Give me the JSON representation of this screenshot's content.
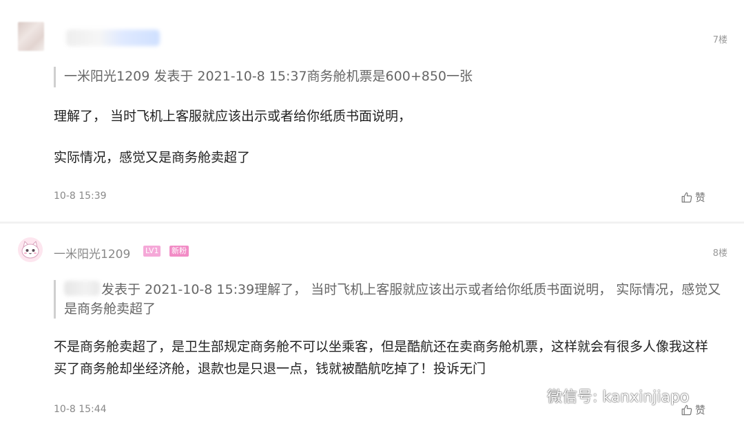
{
  "posts": [
    {
      "floor": "7楼",
      "quote": {
        "text": "一米阳光1209 发表于 2021-10-8 15:37商务舱机票是600+850一张"
      },
      "body_lines": [
        "理解了， 当时飞机上客服就应该出示或者给你纸质书面说明，",
        "实际情况，感觉又是商务舱卖超了"
      ],
      "time": "10-8 15:39",
      "like_label": "赞"
    },
    {
      "username": "一米阳光1209",
      "badges": {
        "level": "LV1",
        "new": "新粉"
      },
      "floor": "8楼",
      "quote": {
        "text": "发表于 2021-10-8 15:39理解了， 当时飞机上客服就应该出示或者给你纸质书面说明， 实际情况，感觉又是商务舱卖超了"
      },
      "body": "不是商务舱卖超了，是卫生部规定商务舱不可以坐乘客，但是酷航还在卖商务舱机票，这样就会有很多人像我这样买了商务舱却坐经济舱，退款也是只退一点，钱就被酷航吃掉了！投诉无门",
      "time": "10-8 15:44",
      "like_label": "赞"
    }
  ],
  "watermark": {
    "text": "微信号: kanxinjiapo",
    "icon": "wechat-icon"
  },
  "colors": {
    "badge_level": "#f5a8d8",
    "badge_new": "#f28cc6",
    "quote_bar": "#cfcfcf",
    "separator": "#f1f1f1"
  }
}
